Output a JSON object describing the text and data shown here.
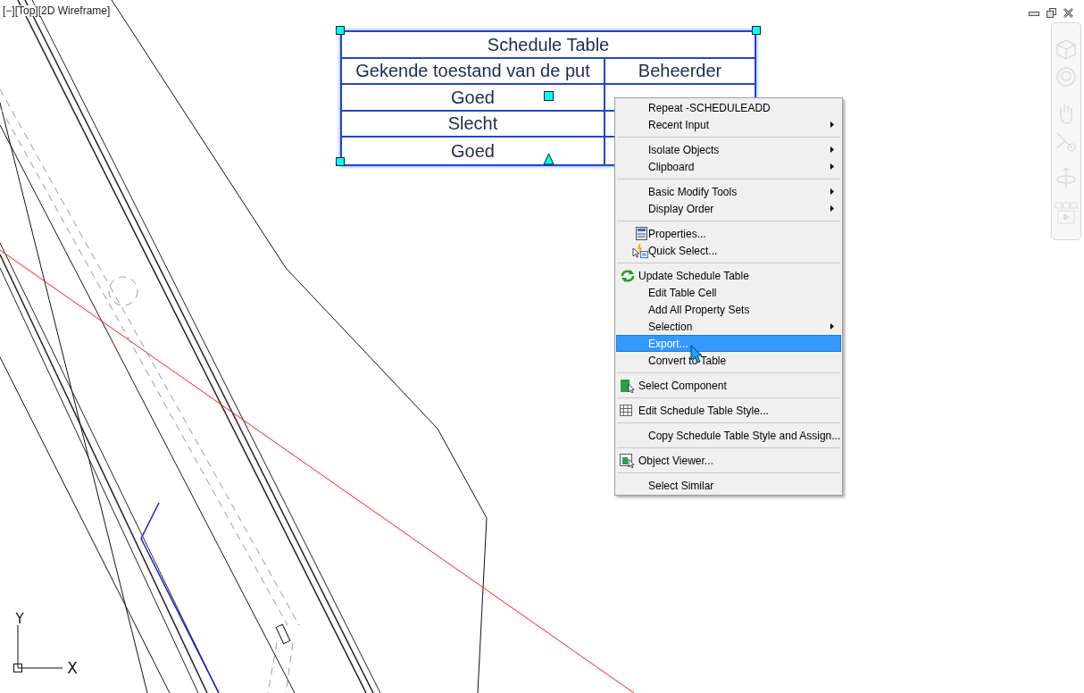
{
  "viewport_label": "[−][Top][2D Wireframe]",
  "schedule_table": {
    "title": "Schedule Table",
    "columns": [
      "Gekende toestand van de put",
      "Beheerder"
    ],
    "rows": [
      [
        "Goed"
      ],
      [
        "Slecht"
      ],
      [
        "Goed"
      ]
    ]
  },
  "context_menu": [
    {
      "kind": "item",
      "label": "Repeat -SCHEDULEADD",
      "submenu": false,
      "selected": false
    },
    {
      "kind": "item",
      "label": "Recent Input",
      "submenu": true,
      "selected": false
    },
    {
      "kind": "separator"
    },
    {
      "kind": "item",
      "label": "Isolate Objects",
      "submenu": true,
      "selected": false
    },
    {
      "kind": "item",
      "label": "Clipboard",
      "submenu": true,
      "selected": false
    },
    {
      "kind": "separator"
    },
    {
      "kind": "item",
      "label": "Basic Modify Tools",
      "submenu": true,
      "selected": false
    },
    {
      "kind": "item",
      "label": "Display Order",
      "submenu": true,
      "selected": false
    },
    {
      "kind": "separator"
    },
    {
      "kind": "icon",
      "label": "Properties...",
      "submenu": false,
      "selected": false
    },
    {
      "kind": "icon",
      "label": "Quick Select...",
      "submenu": false,
      "selected": false
    },
    {
      "kind": "separator"
    },
    {
      "kind": "wideicon",
      "label": "Update Schedule Table",
      "submenu": false,
      "selected": false
    },
    {
      "kind": "item",
      "label": "Edit Table Cell",
      "submenu": false,
      "selected": false
    },
    {
      "kind": "item",
      "label": "Add All Property Sets",
      "submenu": false,
      "selected": false
    },
    {
      "kind": "item",
      "label": "Selection",
      "submenu": true,
      "selected": false
    },
    {
      "kind": "item",
      "label": "Export...",
      "submenu": false,
      "selected": true
    },
    {
      "kind": "item",
      "label": "Convert to Table",
      "submenu": false,
      "selected": false
    },
    {
      "kind": "separator"
    },
    {
      "kind": "wideicon",
      "label": "Select Component",
      "submenu": false,
      "selected": false
    },
    {
      "kind": "separator"
    },
    {
      "kind": "wideicon",
      "label": "Edit Schedule Table Style...",
      "submenu": false,
      "selected": false
    },
    {
      "kind": "separator"
    },
    {
      "kind": "item",
      "label": "Copy Schedule Table Style and Assign...",
      "submenu": false,
      "selected": false
    },
    {
      "kind": "separator"
    },
    {
      "kind": "wideicon",
      "label": "Object Viewer...",
      "submenu": false,
      "selected": false
    },
    {
      "kind": "separator"
    },
    {
      "kind": "item",
      "label": "Select Similar",
      "submenu": false,
      "selected": false
    }
  ],
  "ucs": {
    "x_label": "X",
    "y_label": "Y"
  }
}
